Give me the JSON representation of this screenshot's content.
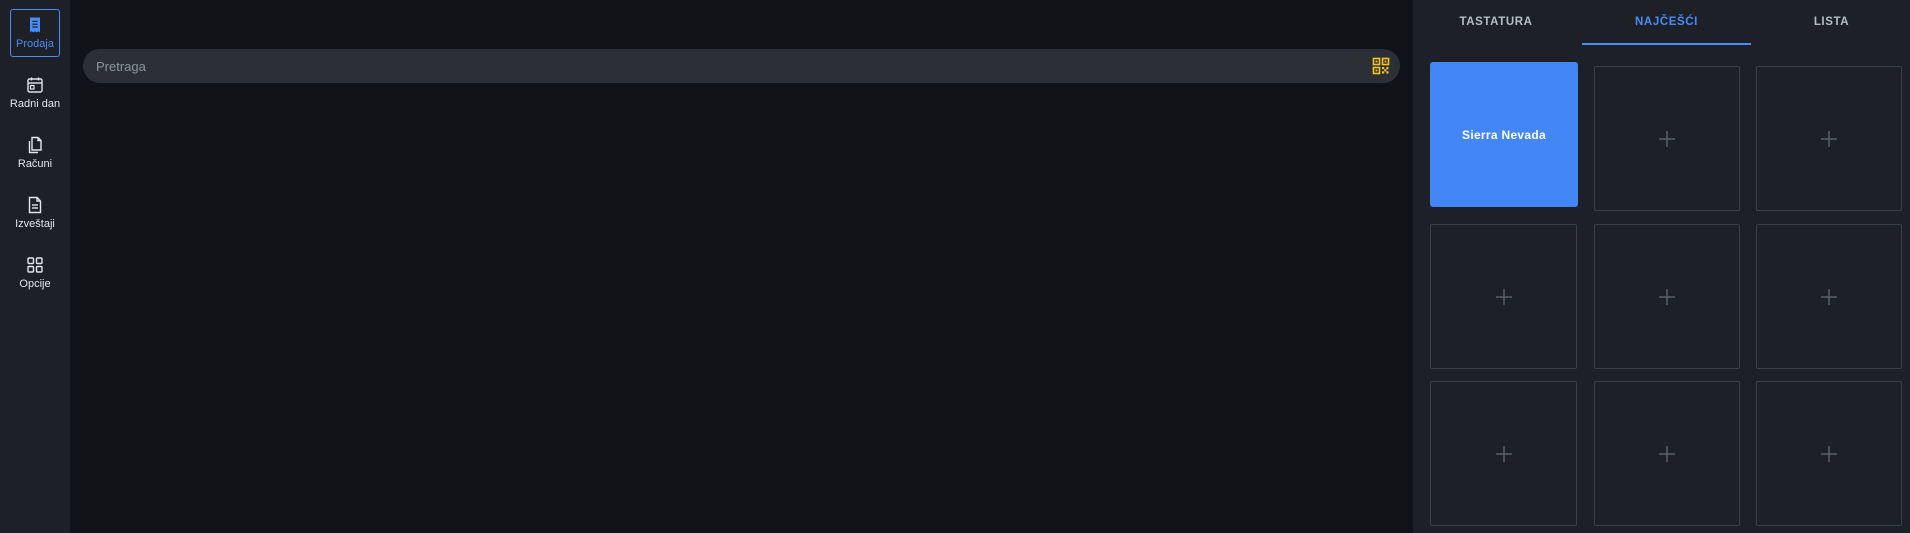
{
  "sidebar": {
    "items": [
      {
        "label": "Prodaja",
        "icon": "receipt-icon",
        "active": true
      },
      {
        "label": "Radni dan",
        "icon": "calendar-icon",
        "active": false
      },
      {
        "label": "Računi",
        "icon": "documents-icon",
        "active": false
      },
      {
        "label": "Izveštaji",
        "icon": "report-icon",
        "active": false
      },
      {
        "label": "Opcije",
        "icon": "grid-icon",
        "active": false
      }
    ]
  },
  "search": {
    "placeholder": "Pretraga",
    "scan_icon": "qr-code-icon"
  },
  "tabs": [
    {
      "label": "TASTATURA",
      "active": false
    },
    {
      "label": "NAJČEŠĆI",
      "active": true
    },
    {
      "label": "LISTA",
      "active": false
    }
  ],
  "tiles": [
    {
      "label": "Sierra Nevada",
      "filled": true
    },
    {
      "label": "",
      "filled": false,
      "icon": "plus-icon"
    },
    {
      "label": "",
      "filled": false,
      "icon": "plus-icon"
    },
    {
      "label": "",
      "filled": false,
      "icon": "plus-icon"
    },
    {
      "label": "",
      "filled": false,
      "icon": "plus-icon"
    },
    {
      "label": "",
      "filled": false,
      "icon": "plus-icon"
    },
    {
      "label": "",
      "filled": false,
      "icon": "plus-icon"
    },
    {
      "label": "",
      "filled": false,
      "icon": "plus-icon"
    },
    {
      "label": "",
      "filled": false,
      "icon": "plus-icon"
    }
  ],
  "colors": {
    "accent": "#4a8cf7",
    "tile_active": "#4287f5",
    "qr_icon": "#f3c623",
    "background": "#111319",
    "panel": "#1d2027"
  }
}
